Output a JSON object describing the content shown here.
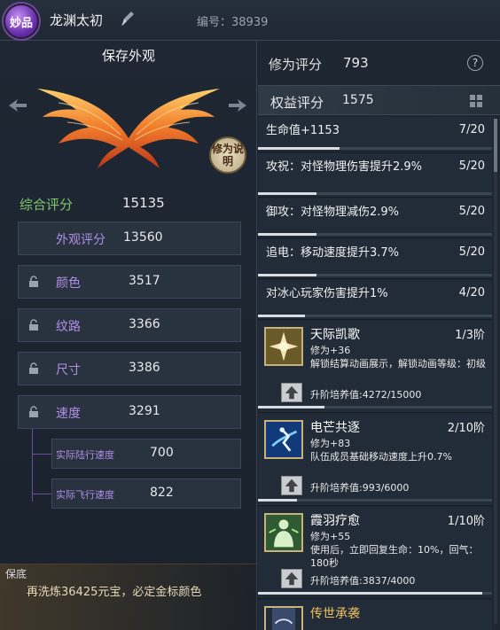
{
  "header": {
    "quality_badge": "妙品",
    "item_name": "龙渊太初",
    "id_text": "编号：38939"
  },
  "appearance": {
    "save_label": "保存外观",
    "explain_label": "修为说明"
  },
  "scores": {
    "overall_label": "综合评分",
    "overall_value": "15135",
    "rows": [
      {
        "label": "外观评分",
        "value": "13560"
      },
      {
        "label": "颜色",
        "value": "3517"
      },
      {
        "label": "纹路",
        "value": "3366"
      },
      {
        "label": "尺寸",
        "value": "3386"
      },
      {
        "label": "速度",
        "value": "3291"
      }
    ],
    "sub_rows": [
      {
        "label": "实际陆行速度",
        "value": "700"
      },
      {
        "label": "实际飞行速度",
        "value": "822"
      }
    ]
  },
  "guarantee": {
    "title": "保底",
    "text": "再洗炼36425元宝，必定金标颜色"
  },
  "cultivation": {
    "label": "修为评分",
    "value": "793",
    "help": "?"
  },
  "rights": {
    "label": "权益评分",
    "value": "1575"
  },
  "stats": [
    {
      "text": "生命值+1153",
      "count": "7/20",
      "progress": 0.35
    },
    {
      "text": "攻祝：对怪物理伤害提升2.9%",
      "count": "5/20",
      "progress": 0.25
    },
    {
      "text": "御攻：对怪物理减伤2.9%",
      "count": "5/20",
      "progress": 0.25
    },
    {
      "text": "追电：移动速度提升3.7%",
      "count": "5/20",
      "progress": 0.25
    },
    {
      "text": "对冰心玩家伤害提升1%",
      "count": "4/20",
      "progress": 0.2
    }
  ],
  "skills": [
    {
      "name": "天际凯歌",
      "stage": "1/3阶",
      "desc": "修为+36\n解锁结算动画展示，解锁动画等级：初级",
      "progress_text": "升阶培养值:4272/15000",
      "progress": 0.285
    },
    {
      "name": "电芒共逐",
      "stage": "2/10阶",
      "desc": "修为+83\n队伍成员基础移动速度上升0.7%",
      "progress_text": "升阶培养值:993/6000",
      "progress": 0.165
    },
    {
      "name": "霞羽疗愈",
      "stage": "1/10阶",
      "desc": "修为+55\n使用后，立即回复生命：10%，回气：180秒",
      "progress_text": "升阶培养值:3837/4000",
      "progress": 0.96
    },
    {
      "name": "传世承袭",
      "stage": "",
      "desc": "",
      "progress_text": "",
      "progress": 0
    }
  ],
  "colors": {
    "purple_label": "#b28ee6",
    "green_label": "#7ec86b",
    "gold": "#f0c060"
  }
}
